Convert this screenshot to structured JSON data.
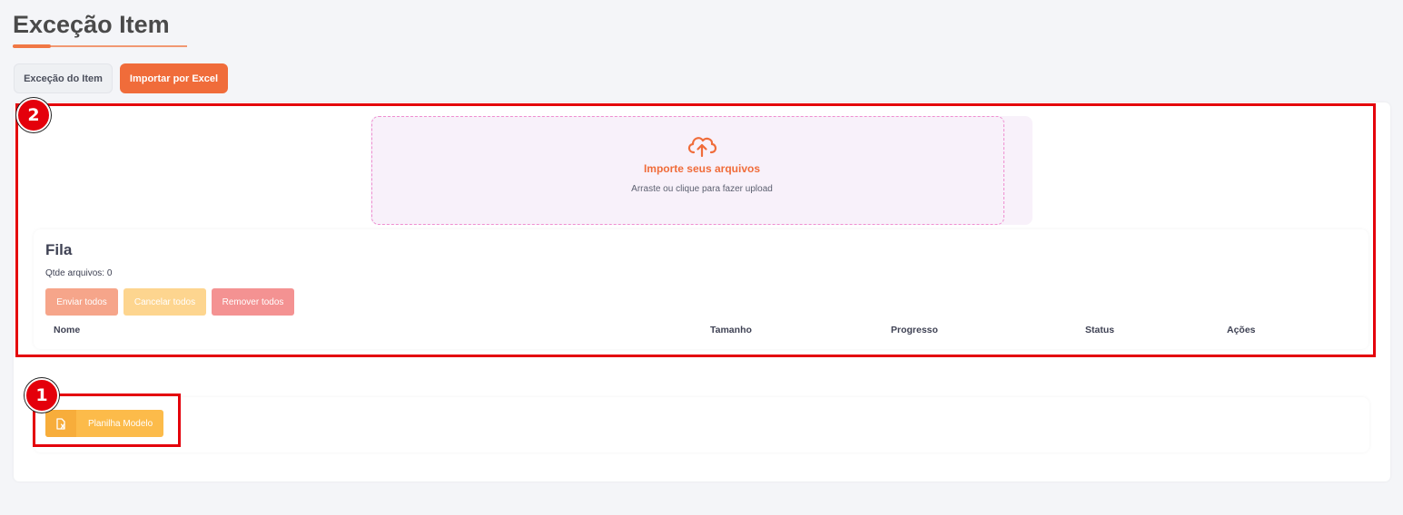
{
  "page": {
    "title": "Exceção Item"
  },
  "tabs": {
    "excecao_label": "Exceção do Item",
    "importar_label": "Importar por Excel"
  },
  "dropzone": {
    "title": "Importe seus arquivos",
    "subtitle": "Arraste ou clique para fazer upload",
    "icon": "cloud-upload-icon"
  },
  "queue": {
    "title": "Fila",
    "count_text": "Qtde arquivos: 0",
    "buttons": {
      "send_all": "Enviar todos",
      "cancel_all": "Cancelar todos",
      "remove_all": "Remover todos"
    },
    "columns": [
      "Nome",
      "Tamanho",
      "Progresso",
      "Status",
      "Ações"
    ]
  },
  "template": {
    "button_label": "Planilha Modelo",
    "icon": "file-excel-icon"
  },
  "annotations": {
    "badge_1": "1",
    "badge_2": "2"
  },
  "colors": {
    "accent": "#f06c3a",
    "annotation": "#e4000b",
    "warning": "#fcbb4a"
  }
}
